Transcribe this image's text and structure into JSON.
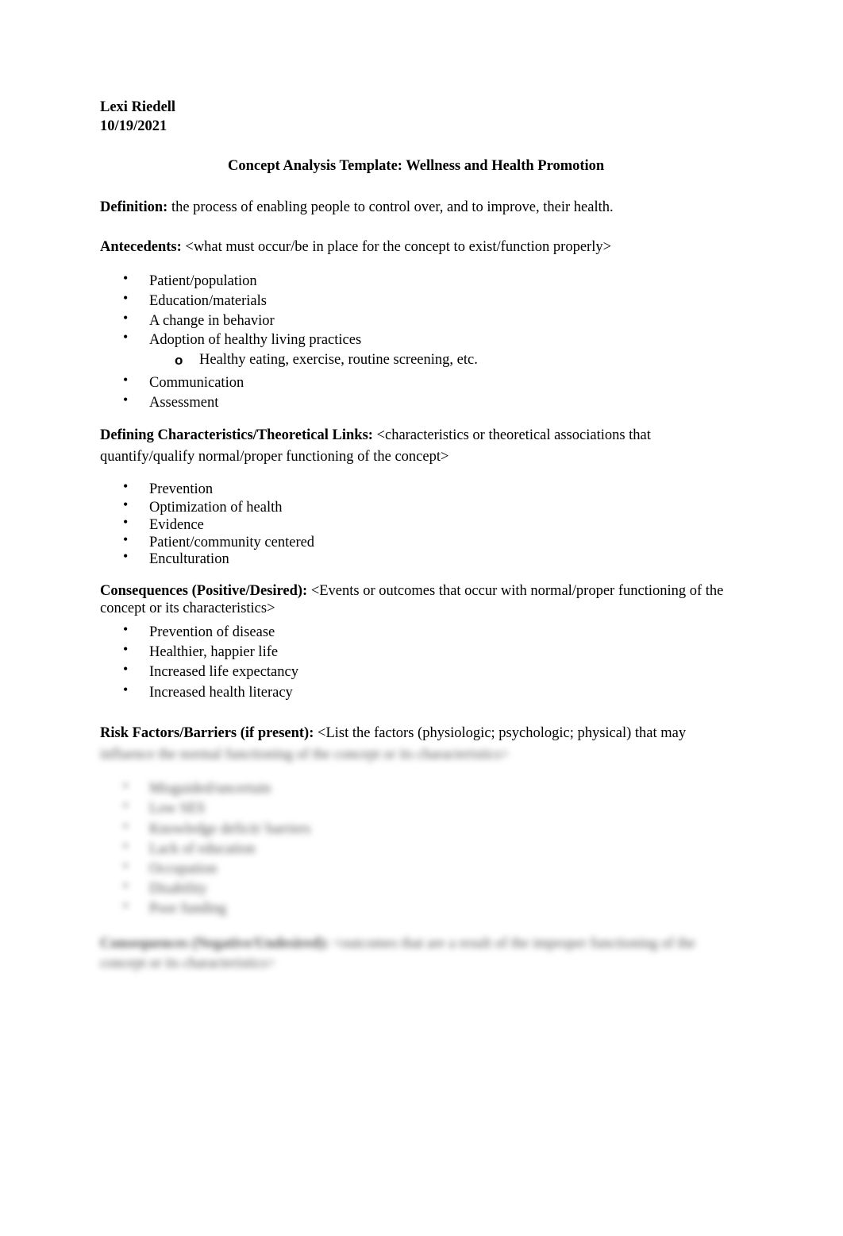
{
  "header": {
    "author": "Lexi Riedell",
    "date": "10/19/2021"
  },
  "title": "Concept Analysis Template: Wellness and Health Promotion",
  "definition": {
    "label": "Definition:",
    "text": " the process of enabling people to control over, and to improve, their health."
  },
  "antecedents": {
    "label": "Antecedents:",
    "prompt": " <what must occur/be in place for the concept to exist/function properly>",
    "items": [
      "Patient/population",
      "Education/materials",
      "A change in behavior",
      "Adoption of healthy living practices",
      "Communication",
      "Assessment"
    ],
    "sub_items": [
      "Healthy eating, exercise, routine screening, etc."
    ],
    "bullet_glyph": "•",
    "sub_bullet_glyph": "o"
  },
  "defining_characteristics": {
    "label": "Defining Characteristics/Theoretical Links:",
    "prompt_line1": " <characteristics or theoretical associations that",
    "prompt_line2": "quantify/qualify normal/proper functioning of the concept>",
    "items": [
      "Prevention",
      "Optimization of health",
      "Evidence",
      "Patient/community centered",
      "Enculturation"
    ]
  },
  "consequences_positive": {
    "label": "Consequences (Positive/Desired):",
    "prompt_line1": " <Events or outcomes that occur with normal/proper functioning of the",
    "prompt_line2": "concept or its characteristics>",
    "items": [
      "Prevention of disease",
      "Healthier, happier life",
      "Increased life expectancy",
      "Increased health literacy"
    ]
  },
  "risk_factors": {
    "label": "Risk Factors/Barriers (if present):",
    "prompt_line1": " <List the factors (physiologic; psychologic; physical) that may",
    "prompt_line2_blurred": "influence the normal functioning of the concept or its characteristics>",
    "items_blurred": [
      "Misguided/uncertain",
      "Low SES",
      "Knowledge deficit/ barriers",
      "Lack of education",
      "Occupation",
      "Disability",
      "Poor funding"
    ]
  },
  "consequences_negative_blurred": {
    "label": "Consequences (Negative/Undesired):",
    "prompt_line1": " <outcomes that are a result of the improper functioning of the",
    "prompt_line2": "concept or its characteristics>"
  }
}
